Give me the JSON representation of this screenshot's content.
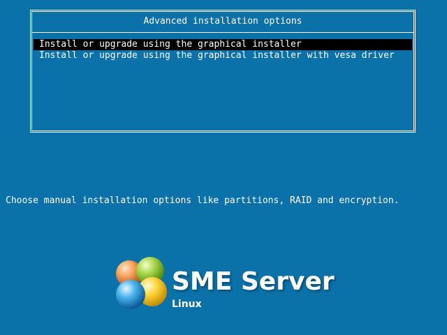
{
  "menu": {
    "title": "Advanced installation options",
    "items": [
      {
        "label": "Install or upgrade using the graphical installer",
        "selected": true
      },
      {
        "label": "Install or upgrade using the graphical installer with vesa driver",
        "selected": false
      }
    ]
  },
  "help_text": "Choose manual installation options like partitions, RAID and encryption.",
  "logo": {
    "name": "SME Server",
    "subtitle": "Linux",
    "icon": "colored-spheres-logo-icon"
  },
  "colors": {
    "background": "#0b71a9",
    "selection": "#000000",
    "text": "#ffffff"
  }
}
